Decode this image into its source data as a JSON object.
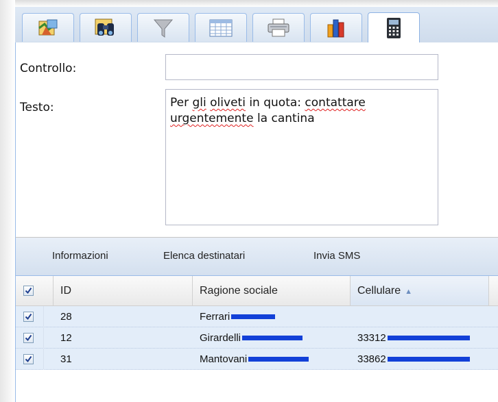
{
  "tabs": [
    {
      "icon": "map-layers-icon"
    },
    {
      "icon": "binoculars-icon"
    },
    {
      "icon": "filter-funnel-icon"
    },
    {
      "icon": "table-grid-icon"
    },
    {
      "icon": "printer-icon"
    },
    {
      "icon": "bar-chart-icon"
    },
    {
      "icon": "calculator-phone-icon",
      "active": true
    }
  ],
  "form": {
    "control_label": "Controllo:",
    "control_value": "",
    "text_label": "Testo:",
    "text_value_words": [
      "Per",
      "gli",
      "oliveti",
      "in quota:",
      "contattare",
      "urgentemente",
      "la cantina"
    ]
  },
  "toolbar": {
    "info_label": "Informazioni",
    "list_label": "Elenca destinatari",
    "send_label": "Invia SMS"
  },
  "grid": {
    "columns": {
      "id": "ID",
      "name": "Ragione sociale",
      "phone": "Cellulare"
    },
    "sorted_column": "phone",
    "sort_direction": "ascending",
    "rows": [
      {
        "id": "28",
        "name": "Ferrari",
        "phone": "",
        "checked": true
      },
      {
        "id": "12",
        "name": "Girardelli",
        "phone": "33312",
        "checked": true
      },
      {
        "id": "31",
        "name": "Mantovani",
        "phone": "33862",
        "checked": true
      }
    ]
  },
  "colors": {
    "accent_border": "#99bbe8",
    "selected_row": "#e3edf9",
    "redaction": "#1240d8"
  }
}
